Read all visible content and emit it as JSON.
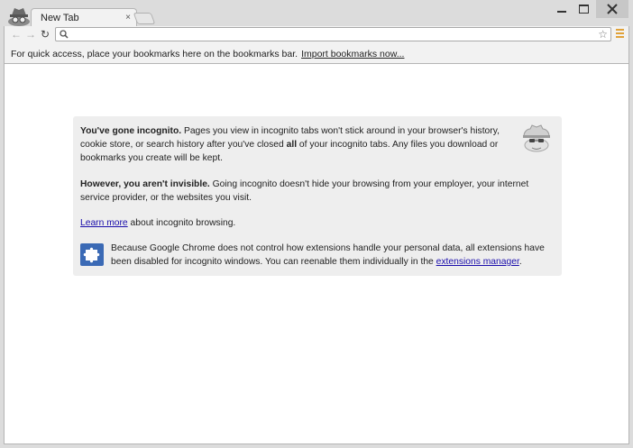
{
  "window": {
    "tab_title": "New Tab",
    "tab_close_glyph": "×",
    "logo_icon": "incognito-spy-icon"
  },
  "toolbar": {
    "back_glyph": "←",
    "forward_glyph": "→",
    "reload_glyph": "↻",
    "omnibox_value": "",
    "star_glyph": "☆"
  },
  "bookmarks_bar": {
    "text": "For quick access, place your bookmarks here on the bookmarks bar.",
    "import_link": "Import bookmarks now..."
  },
  "incognito": {
    "p1_bold": "You've gone incognito.",
    "p1_text_a": " Pages you view in incognito tabs won't stick around in your browser's history, cookie store, or search history after you've closed ",
    "p1_bold_all": "all",
    "p1_text_b": " of your incognito tabs. Any files you download or bookmarks you create will be kept.",
    "p2_bold": "However, you aren't invisible.",
    "p2_text": " Going incognito doesn't hide your browsing from your employer, your internet service provider, or the websites you visit.",
    "learn_more_link": "Learn more",
    "learn_more_text": " about incognito browsing.",
    "ext_text": "Because Google Chrome does not control how extensions handle your personal data, all extensions have been disabled for incognito windows. You can reenable them individually in the ",
    "ext_link": "extensions manager",
    "ext_end": "."
  },
  "colors": {
    "frame": "#dcdcdc",
    "box_bg": "#eeeeee",
    "link": "#1a0dab",
    "menu_accent": "#e0a23a",
    "puzzle_blue": "#3b6ab5"
  }
}
